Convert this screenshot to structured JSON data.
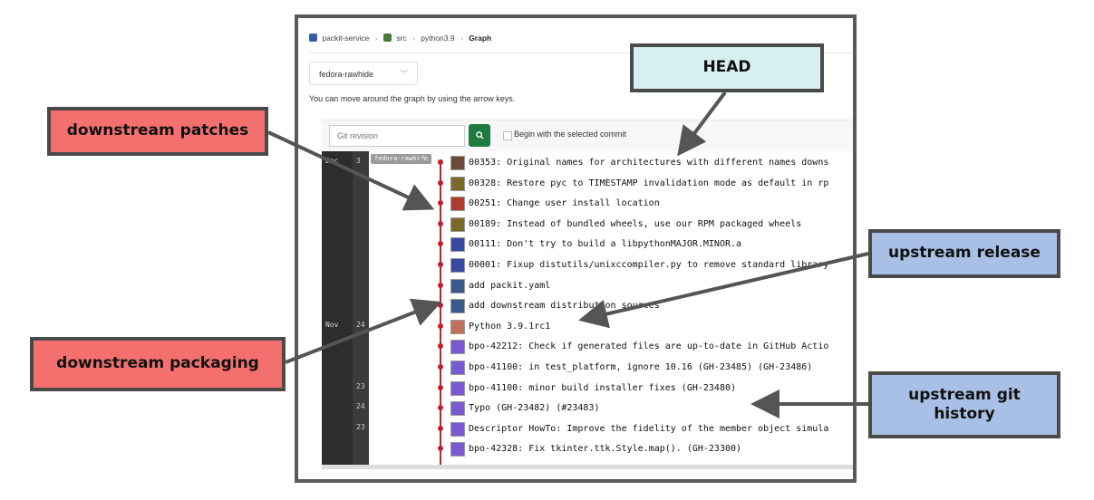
{
  "breadcrumb": {
    "items": [
      "packit-service",
      "src",
      "python3.9"
    ],
    "current": "Graph",
    "separator": "›"
  },
  "branch_select": {
    "value": "fedora-rawhide"
  },
  "hint": "You can move around the graph by using the arrow keys.",
  "toolbar": {
    "revision_placeholder": "Git revision",
    "search_icon": "search-icon",
    "checkbox_label": "Begin with the selected commit"
  },
  "graph": {
    "months": [
      {
        "label": "Dec",
        "row": 0
      },
      {
        "label": "Nov",
        "row": 8
      }
    ],
    "branch_tag": "fedora-rawhide",
    "commits": [
      {
        "day": "3",
        "message": "00353: Original names for architectures with different names downs",
        "avatar_color": "#6b4a3a"
      },
      {
        "day": "",
        "message": "00328: Restore pyc to TIMESTAMP invalidation mode as default in rp",
        "avatar_color": "#7a6a2a"
      },
      {
        "day": "",
        "message": "00251: Change user install location",
        "avatar_color": "#b03a2e"
      },
      {
        "day": "",
        "message": "00189: Instead of bundled wheels, use our RPM packaged wheels",
        "avatar_color": "#7a6a2a"
      },
      {
        "day": "",
        "message": "00111: Don't try to build a libpythonMAJOR.MINOR.a",
        "avatar_color": "#3a4aa0"
      },
      {
        "day": "",
        "message": "00001: Fixup distutils/unixccompiler.py to remove standard library",
        "avatar_color": "#3a4aa0"
      },
      {
        "day": "",
        "message": "add packit.yaml",
        "avatar_color": "#3a5a8a"
      },
      {
        "day": "",
        "message": "add downstream distribution sources",
        "avatar_color": "#3a5a8a"
      },
      {
        "day": "24",
        "message": "Python 3.9.1rc1",
        "avatar_color": "#c0705a"
      },
      {
        "day": "",
        "message": "bpo-42212: Check if generated files are up-to-date in GitHub Actio",
        "avatar_color": "#7a5ad0"
      },
      {
        "day": "",
        "message": "bpo-41100: in test_platform, ignore 10.16 (GH-23485) (GH-23486)",
        "avatar_color": "#7a5ad0"
      },
      {
        "day": "23",
        "message": "bpo-41100: minor build installer fixes (GH-23480)",
        "avatar_color": "#7a5ad0"
      },
      {
        "day": "24",
        "message": "Typo (GH-23482) (#23483)",
        "avatar_color": "#7a5ad0"
      },
      {
        "day": "23",
        "message": "Descriptor HowTo: Improve the fidelity of the member object simula",
        "avatar_color": "#7a5ad0"
      },
      {
        "day": "",
        "message": "bpo-42328: Fix tkinter.ttk.Style.map(). (GH-23300)",
        "avatar_color": "#7a5ad0"
      }
    ]
  },
  "callouts": {
    "head": "HEAD",
    "downstream_patches": "downstream patches",
    "upstream_release": "upstream release",
    "downstream_packaging": "downstream packaging",
    "upstream_git_history": "upstream git history"
  },
  "colors": {
    "rail": "#c21e2b",
    "callout_red": "#f4706e",
    "callout_blue": "#a9c0e6",
    "callout_teal": "#d7efef",
    "search_button": "#1f7a3f"
  }
}
